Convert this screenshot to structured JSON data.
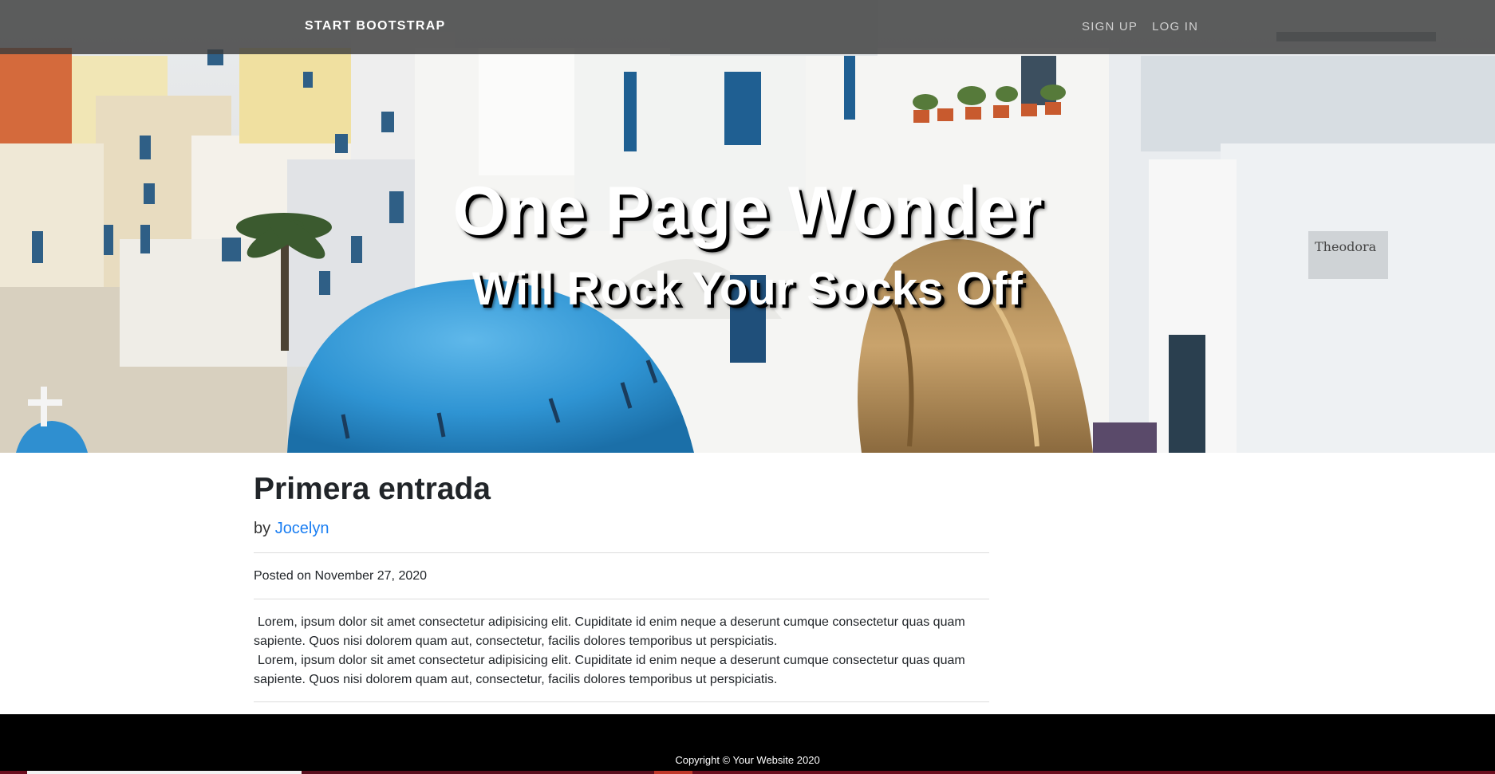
{
  "navbar": {
    "brand": "START BOOTSTRAP",
    "links": [
      {
        "label": "SIGN UP"
      },
      {
        "label": "LOG IN"
      }
    ]
  },
  "hero": {
    "heading": "One Page Wonder",
    "subheading": "Will Rock Your Socks Off",
    "image_icon": "santorini-photo"
  },
  "post": {
    "title": "Primera entrada",
    "by_prefix": "by",
    "author": "Jocelyn",
    "posted_on": "Posted on November 27, 2020",
    "paragraphs": [
      "Lorem, ipsum dolor sit amet consectetur adipisicing elit. Cupiditate id enim neque a deserunt cumque consectetur quas quam sapiente. Quos nisi dolorem quam aut, consectetur, facilis dolores temporibus ut perspiciatis.",
      "Lorem, ipsum dolor sit amet consectetur adipisicing elit. Cupiditate id enim neque a deserunt cumque consectetur quas quam sapiente. Quos nisi dolorem quam aut, consectetur, facilis dolores temporibus ut perspiciatis."
    ]
  },
  "footer": {
    "copyright": "Copyright © Your Website 2020"
  },
  "colors": {
    "link": "#1a7ef2",
    "navbar_bg": "#3c3c3c",
    "footer_bg": "#000000"
  }
}
